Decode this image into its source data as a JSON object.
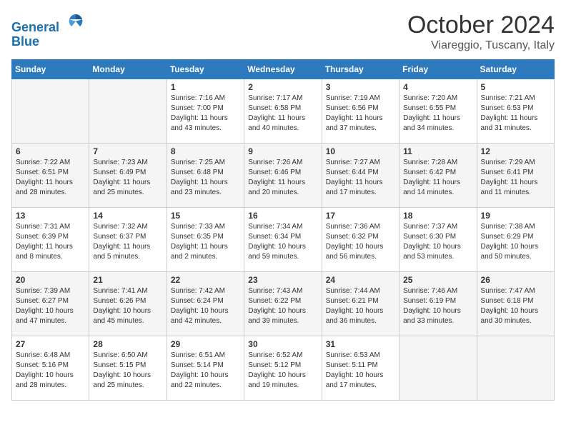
{
  "header": {
    "logo_line1": "General",
    "logo_line2": "Blue",
    "month_title": "October 2024",
    "location": "Viareggio, Tuscany, Italy"
  },
  "weekdays": [
    "Sunday",
    "Monday",
    "Tuesday",
    "Wednesday",
    "Thursday",
    "Friday",
    "Saturday"
  ],
  "weeks": [
    [
      {
        "day": "",
        "info": ""
      },
      {
        "day": "",
        "info": ""
      },
      {
        "day": "1",
        "info": "Sunrise: 7:16 AM\nSunset: 7:00 PM\nDaylight: 11 hours and 43 minutes."
      },
      {
        "day": "2",
        "info": "Sunrise: 7:17 AM\nSunset: 6:58 PM\nDaylight: 11 hours and 40 minutes."
      },
      {
        "day": "3",
        "info": "Sunrise: 7:19 AM\nSunset: 6:56 PM\nDaylight: 11 hours and 37 minutes."
      },
      {
        "day": "4",
        "info": "Sunrise: 7:20 AM\nSunset: 6:55 PM\nDaylight: 11 hours and 34 minutes."
      },
      {
        "day": "5",
        "info": "Sunrise: 7:21 AM\nSunset: 6:53 PM\nDaylight: 11 hours and 31 minutes."
      }
    ],
    [
      {
        "day": "6",
        "info": "Sunrise: 7:22 AM\nSunset: 6:51 PM\nDaylight: 11 hours and 28 minutes."
      },
      {
        "day": "7",
        "info": "Sunrise: 7:23 AM\nSunset: 6:49 PM\nDaylight: 11 hours and 25 minutes."
      },
      {
        "day": "8",
        "info": "Sunrise: 7:25 AM\nSunset: 6:48 PM\nDaylight: 11 hours and 23 minutes."
      },
      {
        "day": "9",
        "info": "Sunrise: 7:26 AM\nSunset: 6:46 PM\nDaylight: 11 hours and 20 minutes."
      },
      {
        "day": "10",
        "info": "Sunrise: 7:27 AM\nSunset: 6:44 PM\nDaylight: 11 hours and 17 minutes."
      },
      {
        "day": "11",
        "info": "Sunrise: 7:28 AM\nSunset: 6:42 PM\nDaylight: 11 hours and 14 minutes."
      },
      {
        "day": "12",
        "info": "Sunrise: 7:29 AM\nSunset: 6:41 PM\nDaylight: 11 hours and 11 minutes."
      }
    ],
    [
      {
        "day": "13",
        "info": "Sunrise: 7:31 AM\nSunset: 6:39 PM\nDaylight: 11 hours and 8 minutes."
      },
      {
        "day": "14",
        "info": "Sunrise: 7:32 AM\nSunset: 6:37 PM\nDaylight: 11 hours and 5 minutes."
      },
      {
        "day": "15",
        "info": "Sunrise: 7:33 AM\nSunset: 6:35 PM\nDaylight: 11 hours and 2 minutes."
      },
      {
        "day": "16",
        "info": "Sunrise: 7:34 AM\nSunset: 6:34 PM\nDaylight: 10 hours and 59 minutes."
      },
      {
        "day": "17",
        "info": "Sunrise: 7:36 AM\nSunset: 6:32 PM\nDaylight: 10 hours and 56 minutes."
      },
      {
        "day": "18",
        "info": "Sunrise: 7:37 AM\nSunset: 6:30 PM\nDaylight: 10 hours and 53 minutes."
      },
      {
        "day": "19",
        "info": "Sunrise: 7:38 AM\nSunset: 6:29 PM\nDaylight: 10 hours and 50 minutes."
      }
    ],
    [
      {
        "day": "20",
        "info": "Sunrise: 7:39 AM\nSunset: 6:27 PM\nDaylight: 10 hours and 47 minutes."
      },
      {
        "day": "21",
        "info": "Sunrise: 7:41 AM\nSunset: 6:26 PM\nDaylight: 10 hours and 45 minutes."
      },
      {
        "day": "22",
        "info": "Sunrise: 7:42 AM\nSunset: 6:24 PM\nDaylight: 10 hours and 42 minutes."
      },
      {
        "day": "23",
        "info": "Sunrise: 7:43 AM\nSunset: 6:22 PM\nDaylight: 10 hours and 39 minutes."
      },
      {
        "day": "24",
        "info": "Sunrise: 7:44 AM\nSunset: 6:21 PM\nDaylight: 10 hours and 36 minutes."
      },
      {
        "day": "25",
        "info": "Sunrise: 7:46 AM\nSunset: 6:19 PM\nDaylight: 10 hours and 33 minutes."
      },
      {
        "day": "26",
        "info": "Sunrise: 7:47 AM\nSunset: 6:18 PM\nDaylight: 10 hours and 30 minutes."
      }
    ],
    [
      {
        "day": "27",
        "info": "Sunrise: 6:48 AM\nSunset: 5:16 PM\nDaylight: 10 hours and 28 minutes."
      },
      {
        "day": "28",
        "info": "Sunrise: 6:50 AM\nSunset: 5:15 PM\nDaylight: 10 hours and 25 minutes."
      },
      {
        "day": "29",
        "info": "Sunrise: 6:51 AM\nSunset: 5:14 PM\nDaylight: 10 hours and 22 minutes."
      },
      {
        "day": "30",
        "info": "Sunrise: 6:52 AM\nSunset: 5:12 PM\nDaylight: 10 hours and 19 minutes."
      },
      {
        "day": "31",
        "info": "Sunrise: 6:53 AM\nSunset: 5:11 PM\nDaylight: 10 hours and 17 minutes."
      },
      {
        "day": "",
        "info": ""
      },
      {
        "day": "",
        "info": ""
      }
    ]
  ]
}
